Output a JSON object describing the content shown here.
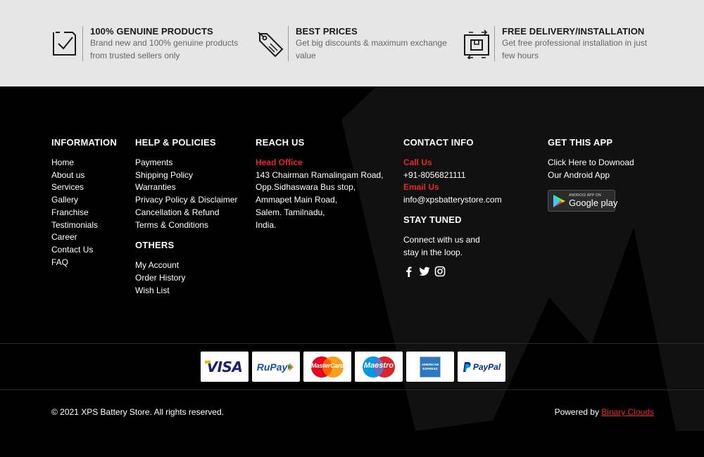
{
  "features": [
    {
      "icon": "checkbox-icon",
      "title": "100% GENUINE PRODUCTS",
      "desc": "Brand new and 100% genuine products from trusted sellers only"
    },
    {
      "icon": "price-tag-icon",
      "title": "BEST PRICES",
      "desc": "Get big discounts & maximum exchange value"
    },
    {
      "icon": "delivery-box-icon",
      "title": "FREE DELIVERY/INSTALLATION",
      "desc": "Get free professional installation in just few hours"
    }
  ],
  "information": {
    "title": "INFORMATION",
    "links": [
      "Home",
      "About us",
      "Services",
      "Gallery",
      "Franchise",
      "Testimonials",
      "Career",
      "Contact Us",
      "FAQ"
    ]
  },
  "help": {
    "title": "HELP & POLICIES",
    "links": [
      "Payments",
      "Shipping Policy",
      "Warranties",
      "Privacy Policy & Disclaimer",
      "Cancellation & Refund",
      "Terms & Conditions"
    ]
  },
  "others": {
    "title": "OTHERS",
    "links": [
      "My Account",
      "Order History",
      "Wish List"
    ]
  },
  "reach": {
    "title": "REACH US",
    "head_office_label": "Head Office",
    "address": [
      "143 Chairman Ramalingam Road,",
      "Opp.Sidhaswara Bus stop,",
      "Ammapet Main Road,",
      "Salem. Tamilnadu,",
      "India."
    ]
  },
  "contact": {
    "title": "CONTACT INFO",
    "call_label": "Call Us",
    "phone": "+91-8056821111",
    "email_label": "Email Us",
    "email": "info@xpsbatterystore.com"
  },
  "stay": {
    "title": "STAY TUNED",
    "text": [
      "Connect with us and",
      "stay in the loop."
    ],
    "social": [
      "facebook-icon",
      "twitter-icon",
      "instagram-icon"
    ]
  },
  "app": {
    "title": "GET THIS APP",
    "text": [
      "Click Here to Downoad",
      "Our Android App"
    ],
    "badge_small": "ANDROID APP ON",
    "badge_big": "Google play"
  },
  "payments": {
    "visa": "VISA",
    "rupay": "RuPay",
    "mastercard": "MasterCard",
    "maestro": "Maestro",
    "amex": "AMERICAN EXPRESS",
    "paypal": "PayPal"
  },
  "bottom": {
    "copyright": "© 2021 XPS Battery Store. All rights reserved.",
    "powered_label": "Powered by",
    "powered_link": "Binary Clouds"
  },
  "colors": {
    "accent": "#e52828",
    "band": "#e6e6e6",
    "footer": "#000000"
  }
}
